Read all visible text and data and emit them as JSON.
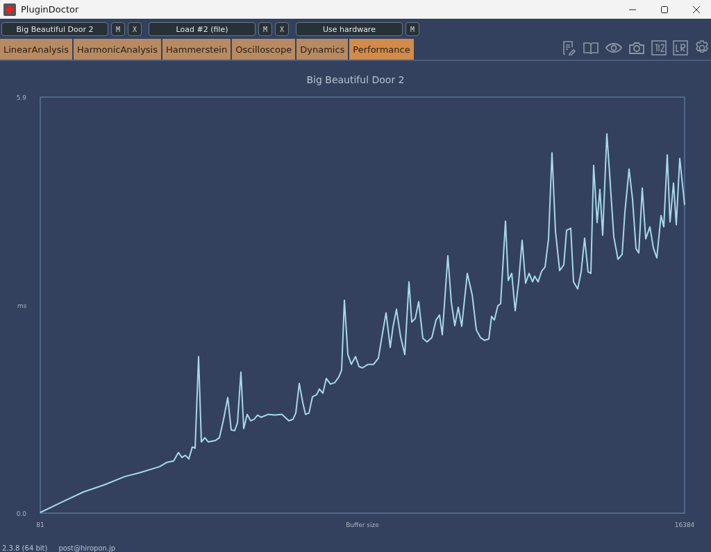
{
  "window": {
    "title": "PluginDoctor"
  },
  "slots": [
    {
      "label": "Big Beautiful Door 2",
      "buttons": [
        "M",
        "X"
      ]
    },
    {
      "label": "Load #2 (file)",
      "buttons": [
        "M",
        "X"
      ]
    },
    {
      "label": "Use hardware",
      "buttons": [
        "M"
      ]
    }
  ],
  "tabs": [
    {
      "label": "LinearAnalysis",
      "selected": false
    },
    {
      "label": "HarmonicAnalysis",
      "selected": false
    },
    {
      "label": "Hammerstein",
      "selected": false
    },
    {
      "label": "Oscilloscope",
      "selected": false
    },
    {
      "label": "Dynamics",
      "selected": false
    },
    {
      "label": "Performance",
      "selected": true
    }
  ],
  "chart": {
    "chart_data": {
      "type": "line",
      "title": "Big Beautiful Door 2",
      "xlabel": "Buffer size",
      "ylabel": "ms",
      "xlim": [
        81,
        16384
      ],
      "ylim": [
        0,
        5.9
      ],
      "xticks": [
        81,
        16384
      ],
      "yticks": [
        {
          "value": 0,
          "label": "0.0"
        },
        {
          "value": 5.9,
          "label": "5.9"
        }
      ],
      "x": [
        81,
        643,
        1170,
        1697,
        2224,
        2576,
        3103,
        3278,
        3454,
        3577,
        3665,
        3753,
        3841,
        3928,
        3999,
        4087,
        4157,
        4245,
        4332,
        4508,
        4614,
        4719,
        4824,
        4912,
        5000,
        5070,
        5158,
        5228,
        5316,
        5404,
        5492,
        5580,
        5668,
        5843,
        6019,
        6195,
        6370,
        6476,
        6546,
        6634,
        6722,
        6792,
        6880,
        6968,
        7073,
        7143,
        7231,
        7319,
        7424,
        7530,
        7635,
        7706,
        7776,
        7864,
        7952,
        8057,
        8145,
        8233,
        8373,
        8514,
        8637,
        8724,
        8830,
        8935,
        9006,
        9093,
        9199,
        9304,
        9410,
        9480,
        9568,
        9656,
        9761,
        9866,
        9989,
        10095,
        10183,
        10253,
        10393,
        10481,
        10569,
        10657,
        10745,
        10885,
        11008,
        11114,
        11219,
        11325,
        11430,
        11500,
        11570,
        11658,
        11729,
        11852,
        11922,
        12010,
        12098,
        12185,
        12273,
        12361,
        12449,
        12537,
        12589,
        12677,
        12765,
        12853,
        12941,
        13029,
        13116,
        13222,
        13327,
        13398,
        13503,
        13573,
        13679,
        13766,
        13854,
        13942,
        14012,
        14083,
        14171,
        14241,
        14311,
        14416,
        14487,
        14592,
        14698,
        14803,
        14873,
        14979,
        15067,
        15154,
        15225,
        15312,
        15400,
        15506,
        15594,
        15681,
        15787,
        15857,
        15945,
        16015,
        16103,
        16173,
        16261,
        16384
      ],
      "series": [
        {
          "color": "#a8d8ea",
          "values": [
            0.01,
            0.16,
            0.3,
            0.4,
            0.52,
            0.57,
            0.66,
            0.72,
            0.74,
            0.86,
            0.79,
            0.82,
            0.77,
            0.94,
            0.92,
            2.22,
            1.01,
            1.07,
            1.01,
            1.03,
            1.07,
            1.33,
            1.64,
            1.18,
            1.17,
            1.28,
            2.0,
            1.2,
            1.4,
            1.31,
            1.33,
            1.39,
            1.36,
            1.4,
            1.39,
            1.4,
            1.31,
            1.33,
            1.42,
            1.84,
            1.57,
            1.4,
            1.42,
            1.65,
            1.68,
            1.76,
            1.7,
            1.91,
            1.83,
            1.85,
            1.93,
            2.03,
            3.02,
            2.25,
            2.11,
            2.22,
            2.08,
            2.06,
            2.11,
            2.11,
            2.2,
            2.5,
            2.84,
            2.35,
            2.64,
            2.89,
            2.5,
            2.25,
            3.28,
            2.71,
            2.76,
            3.0,
            2.48,
            2.43,
            2.49,
            2.74,
            2.81,
            2.53,
            3.65,
            2.99,
            2.66,
            2.92,
            2.65,
            3.4,
            3.1,
            2.6,
            2.49,
            2.45,
            2.47,
            2.79,
            2.74,
            2.94,
            2.97,
            4.14,
            3.3,
            3.4,
            2.87,
            3.28,
            3.87,
            3.26,
            3.4,
            3.28,
            3.36,
            3.28,
            3.43,
            3.49,
            3.89,
            5.11,
            4.0,
            3.44,
            3.52,
            4.01,
            4.04,
            3.28,
            3.18,
            3.42,
            3.9,
            3.42,
            3.4,
            4.93,
            4.12,
            4.59,
            3.94,
            5.38,
            4.81,
            3.92,
            3.6,
            3.67,
            4.27,
            4.88,
            4.45,
            3.75,
            3.69,
            4.61,
            3.89,
            4.06,
            3.76,
            3.62,
            4.22,
            4.06,
            5.08,
            4.13,
            4.68,
            4.09,
            5.03,
            4.37
          ]
        }
      ]
    }
  },
  "status_bar": {
    "version": "2.3.8 (64 bit)",
    "contact": "post@hiropon.jp"
  }
}
